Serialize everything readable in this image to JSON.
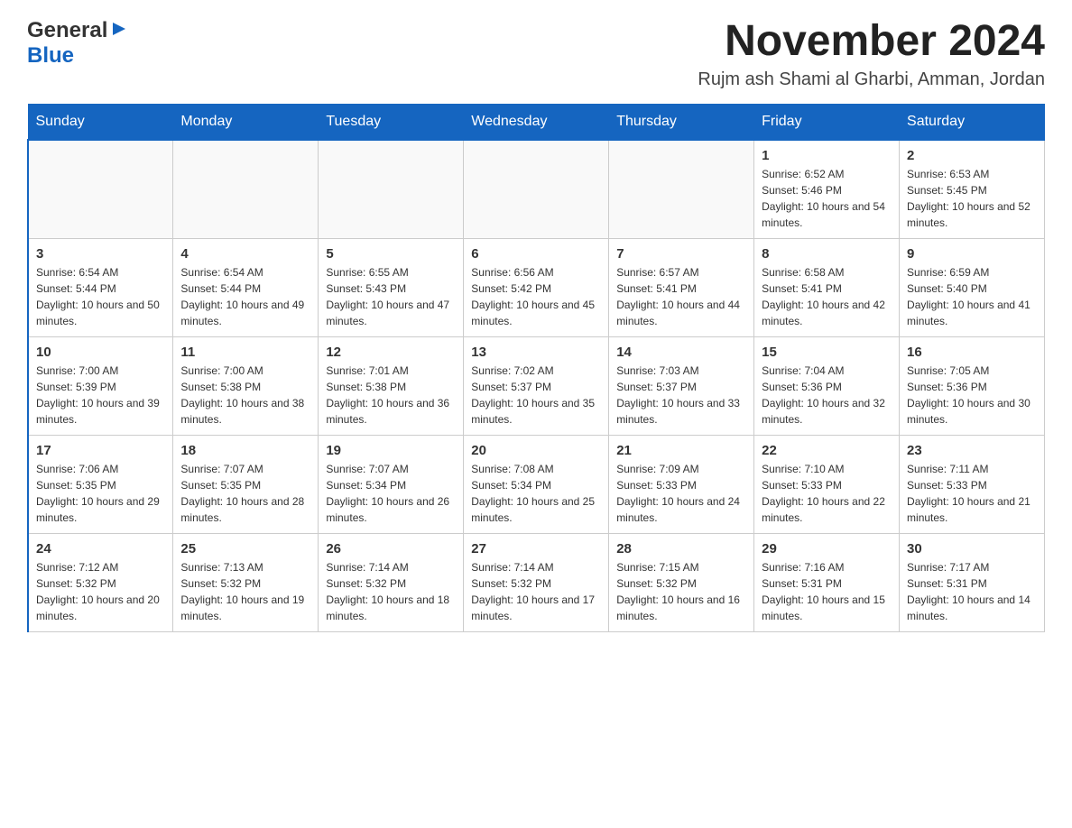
{
  "header": {
    "logo_line1": "General",
    "logo_line2": "Blue",
    "title": "November 2024",
    "subtitle": "Rujm ash Shami al Gharbi, Amman, Jordan"
  },
  "calendar": {
    "days_of_week": [
      "Sunday",
      "Monday",
      "Tuesday",
      "Wednesday",
      "Thursday",
      "Friday",
      "Saturday"
    ],
    "weeks": [
      {
        "days": [
          {
            "number": "",
            "info": ""
          },
          {
            "number": "",
            "info": ""
          },
          {
            "number": "",
            "info": ""
          },
          {
            "number": "",
            "info": ""
          },
          {
            "number": "",
            "info": ""
          },
          {
            "number": "1",
            "info": "Sunrise: 6:52 AM\nSunset: 5:46 PM\nDaylight: 10 hours and 54 minutes."
          },
          {
            "number": "2",
            "info": "Sunrise: 6:53 AM\nSunset: 5:45 PM\nDaylight: 10 hours and 52 minutes."
          }
        ]
      },
      {
        "days": [
          {
            "number": "3",
            "info": "Sunrise: 6:54 AM\nSunset: 5:44 PM\nDaylight: 10 hours and 50 minutes."
          },
          {
            "number": "4",
            "info": "Sunrise: 6:54 AM\nSunset: 5:44 PM\nDaylight: 10 hours and 49 minutes."
          },
          {
            "number": "5",
            "info": "Sunrise: 6:55 AM\nSunset: 5:43 PM\nDaylight: 10 hours and 47 minutes."
          },
          {
            "number": "6",
            "info": "Sunrise: 6:56 AM\nSunset: 5:42 PM\nDaylight: 10 hours and 45 minutes."
          },
          {
            "number": "7",
            "info": "Sunrise: 6:57 AM\nSunset: 5:41 PM\nDaylight: 10 hours and 44 minutes."
          },
          {
            "number": "8",
            "info": "Sunrise: 6:58 AM\nSunset: 5:41 PM\nDaylight: 10 hours and 42 minutes."
          },
          {
            "number": "9",
            "info": "Sunrise: 6:59 AM\nSunset: 5:40 PM\nDaylight: 10 hours and 41 minutes."
          }
        ]
      },
      {
        "days": [
          {
            "number": "10",
            "info": "Sunrise: 7:00 AM\nSunset: 5:39 PM\nDaylight: 10 hours and 39 minutes."
          },
          {
            "number": "11",
            "info": "Sunrise: 7:00 AM\nSunset: 5:38 PM\nDaylight: 10 hours and 38 minutes."
          },
          {
            "number": "12",
            "info": "Sunrise: 7:01 AM\nSunset: 5:38 PM\nDaylight: 10 hours and 36 minutes."
          },
          {
            "number": "13",
            "info": "Sunrise: 7:02 AM\nSunset: 5:37 PM\nDaylight: 10 hours and 35 minutes."
          },
          {
            "number": "14",
            "info": "Sunrise: 7:03 AM\nSunset: 5:37 PM\nDaylight: 10 hours and 33 minutes."
          },
          {
            "number": "15",
            "info": "Sunrise: 7:04 AM\nSunset: 5:36 PM\nDaylight: 10 hours and 32 minutes."
          },
          {
            "number": "16",
            "info": "Sunrise: 7:05 AM\nSunset: 5:36 PM\nDaylight: 10 hours and 30 minutes."
          }
        ]
      },
      {
        "days": [
          {
            "number": "17",
            "info": "Sunrise: 7:06 AM\nSunset: 5:35 PM\nDaylight: 10 hours and 29 minutes."
          },
          {
            "number": "18",
            "info": "Sunrise: 7:07 AM\nSunset: 5:35 PM\nDaylight: 10 hours and 28 minutes."
          },
          {
            "number": "19",
            "info": "Sunrise: 7:07 AM\nSunset: 5:34 PM\nDaylight: 10 hours and 26 minutes."
          },
          {
            "number": "20",
            "info": "Sunrise: 7:08 AM\nSunset: 5:34 PM\nDaylight: 10 hours and 25 minutes."
          },
          {
            "number": "21",
            "info": "Sunrise: 7:09 AM\nSunset: 5:33 PM\nDaylight: 10 hours and 24 minutes."
          },
          {
            "number": "22",
            "info": "Sunrise: 7:10 AM\nSunset: 5:33 PM\nDaylight: 10 hours and 22 minutes."
          },
          {
            "number": "23",
            "info": "Sunrise: 7:11 AM\nSunset: 5:33 PM\nDaylight: 10 hours and 21 minutes."
          }
        ]
      },
      {
        "days": [
          {
            "number": "24",
            "info": "Sunrise: 7:12 AM\nSunset: 5:32 PM\nDaylight: 10 hours and 20 minutes."
          },
          {
            "number": "25",
            "info": "Sunrise: 7:13 AM\nSunset: 5:32 PM\nDaylight: 10 hours and 19 minutes."
          },
          {
            "number": "26",
            "info": "Sunrise: 7:14 AM\nSunset: 5:32 PM\nDaylight: 10 hours and 18 minutes."
          },
          {
            "number": "27",
            "info": "Sunrise: 7:14 AM\nSunset: 5:32 PM\nDaylight: 10 hours and 17 minutes."
          },
          {
            "number": "28",
            "info": "Sunrise: 7:15 AM\nSunset: 5:32 PM\nDaylight: 10 hours and 16 minutes."
          },
          {
            "number": "29",
            "info": "Sunrise: 7:16 AM\nSunset: 5:31 PM\nDaylight: 10 hours and 15 minutes."
          },
          {
            "number": "30",
            "info": "Sunrise: 7:17 AM\nSunset: 5:31 PM\nDaylight: 10 hours and 14 minutes."
          }
        ]
      }
    ]
  }
}
